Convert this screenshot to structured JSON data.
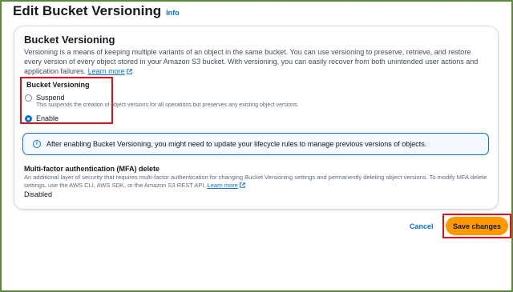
{
  "page": {
    "title": "Edit Bucket Versioning",
    "info_label": "Info"
  },
  "section": {
    "title": "Bucket Versioning",
    "description": "Versioning is a means of keeping multiple variants of an object in the same bucket. You can use versioning to preserve, retrieve, and restore every version of every object stored in your Amazon S3 bucket. With versioning, you can easily recover from both unintended user actions and application failures.",
    "learn_more": "Learn more"
  },
  "versioning_field": {
    "label": "Bucket Versioning",
    "options": [
      {
        "label": "Suspend",
        "help": "This suspends the creation of object versions for all operations but preserves any existing object versions.",
        "selected": false
      },
      {
        "label": "Enable",
        "help": "",
        "selected": true
      }
    ]
  },
  "alert": {
    "icon": "info-icon",
    "text": "After enabling Bucket Versioning, you might need to update your lifecycle rules to manage previous versions of objects."
  },
  "mfa": {
    "title": "Multi-factor authentication (MFA) delete",
    "description": "An additional layer of security that requires multi-factor authentication for changing Bucket Versioning settings and permanently deleting object versions. To modify MFA delete settings, use the AWS CLI, AWS SDK, or the Amazon S3 REST API.",
    "learn_more": "Learn more",
    "value": "Disabled"
  },
  "actions": {
    "cancel_label": "Cancel",
    "save_label": "Save changes"
  },
  "colors": {
    "accent": "#0972d3",
    "primary_button": "#ff9900",
    "highlight": "#e0111c"
  }
}
